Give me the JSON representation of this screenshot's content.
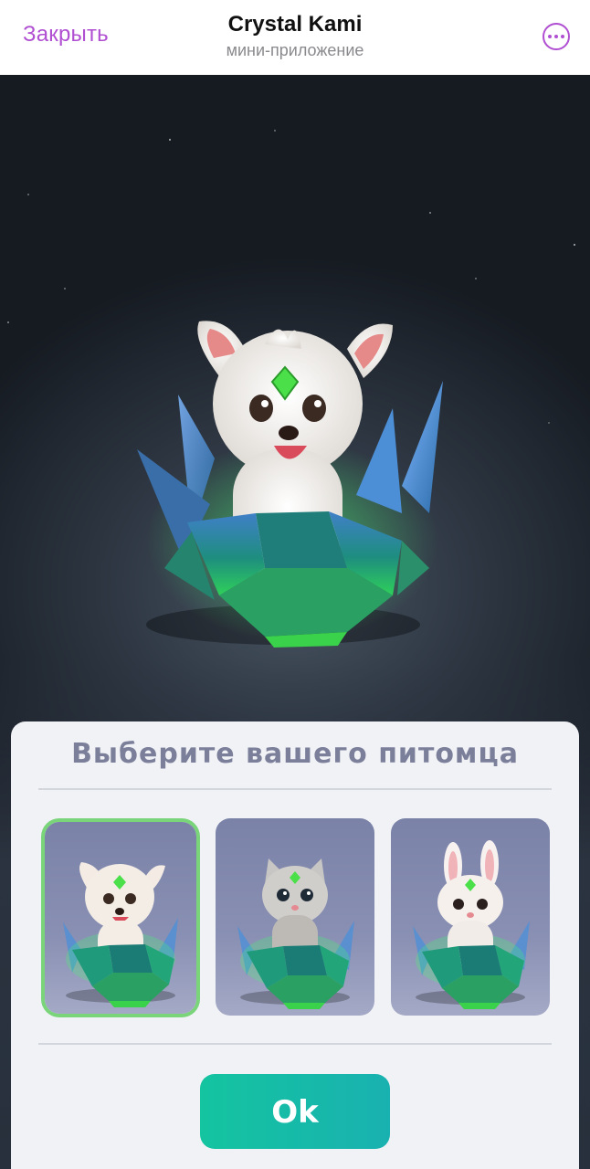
{
  "header": {
    "close_label": "Закрыть",
    "title": "Crystal Kami",
    "subtitle": "мини-приложение",
    "more_icon": "more-options-icon"
  },
  "hero": {
    "pet": "puppy",
    "gem_color": "#3fd13a",
    "crystal_color": "#1fb37a"
  },
  "picker": {
    "title": "Выберите вашего питомца",
    "pets": [
      {
        "id": "puppy",
        "selected": true
      },
      {
        "id": "kitten",
        "selected": false
      },
      {
        "id": "bunny",
        "selected": false
      }
    ],
    "ok_label": "Ok"
  },
  "colors": {
    "accent": "#b04fd2",
    "selected_border": "#79d47a",
    "ok_button": "#14c4a0",
    "sheet_bg": "#f1f2f6",
    "card_bg": "#7b82a8"
  }
}
